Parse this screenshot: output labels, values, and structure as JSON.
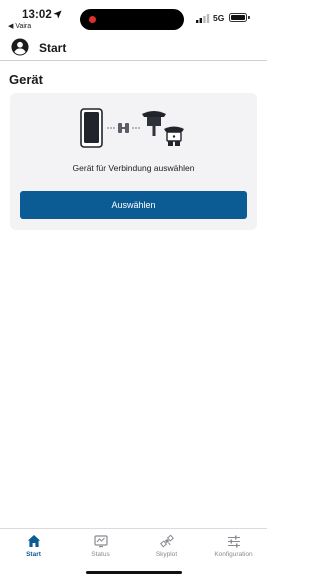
{
  "status_bar": {
    "time": "13:02",
    "back_app": "◀ Vaira",
    "network": "5G",
    "icons": [
      "location-arrow-icon",
      "signal-bars-icon",
      "battery-icon"
    ]
  },
  "header": {
    "title": "Start",
    "icon": "profile-icon"
  },
  "section": {
    "title": "Gerät"
  },
  "card": {
    "message": "Gerät für Verbindung auswählen",
    "button_label": "Auswählen",
    "illustration_icons": [
      "phone-icon",
      "connection-icon",
      "gnss-receiver-icon"
    ]
  },
  "tabs": [
    {
      "label": "Start",
      "icon": "home-icon",
      "active": true
    },
    {
      "label": "Status",
      "icon": "status-monitor-icon",
      "active": false
    },
    {
      "label": "Skyplot",
      "icon": "satellite-icon",
      "active": false
    },
    {
      "label": "Konfiguration",
      "icon": "sliders-icon",
      "active": false
    }
  ],
  "colors": {
    "accent": "#0b5b94",
    "card_background": "#f3f3f6",
    "recording_dot": "#e0302a"
  }
}
